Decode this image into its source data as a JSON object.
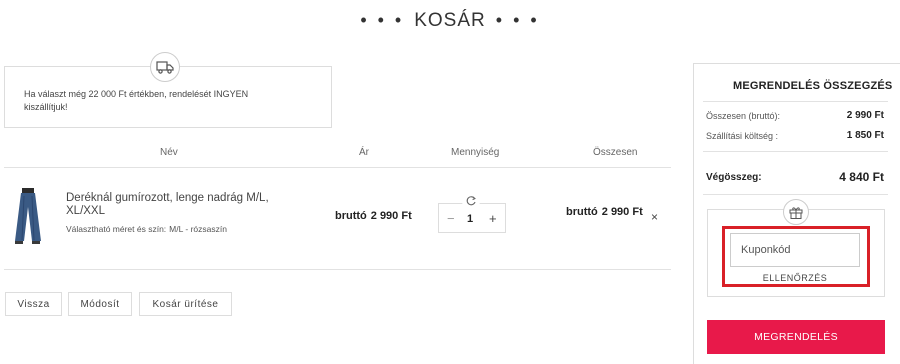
{
  "header": {
    "dots_left": "• • •",
    "title": "KOSÁR",
    "dots_right": "• • •"
  },
  "shipping": {
    "icon": "truck-icon",
    "message": "Ha választ még 22 000 Ft értékben, rendelését INGYEN kiszállítjuk!"
  },
  "table": {
    "headers": {
      "name": "Név",
      "price": "Ár",
      "quantity": "Mennyiség",
      "total": "Összesen"
    }
  },
  "item": {
    "name": "Deréknál gumírozott, lenge nadrág M/L, XL/XXL",
    "variant_label": "Választható méret és szín:",
    "variant_value": "M/L - rózsaszín",
    "price_label": "bruttó",
    "price": "2 990 Ft",
    "quantity": "1",
    "minus": "−",
    "plus": "+",
    "total_label": "bruttó",
    "total": "2 990 Ft",
    "remove": "×"
  },
  "actions": {
    "back": "Vissza",
    "modify": "Módosít",
    "clear": "Kosár ürítése"
  },
  "summary": {
    "title": "MEGRENDELÉS ÖSSZEGZÉS",
    "subtotal_label": "Összesen (bruttó):",
    "subtotal_value": "2 990 Ft",
    "shipping_label": "Szállítási költség :",
    "shipping_value": "1 850 Ft",
    "total_label": "Végösszeg:",
    "total_value": "4 840 Ft",
    "gift_icon": "gift-icon",
    "coupon_placeholder": "Kuponkód",
    "coupon_check": "ELLENŐRZÉS",
    "order_button": "MEGRENDELÉS"
  },
  "colors": {
    "accent": "#e8194a",
    "highlight": "#d92027"
  }
}
